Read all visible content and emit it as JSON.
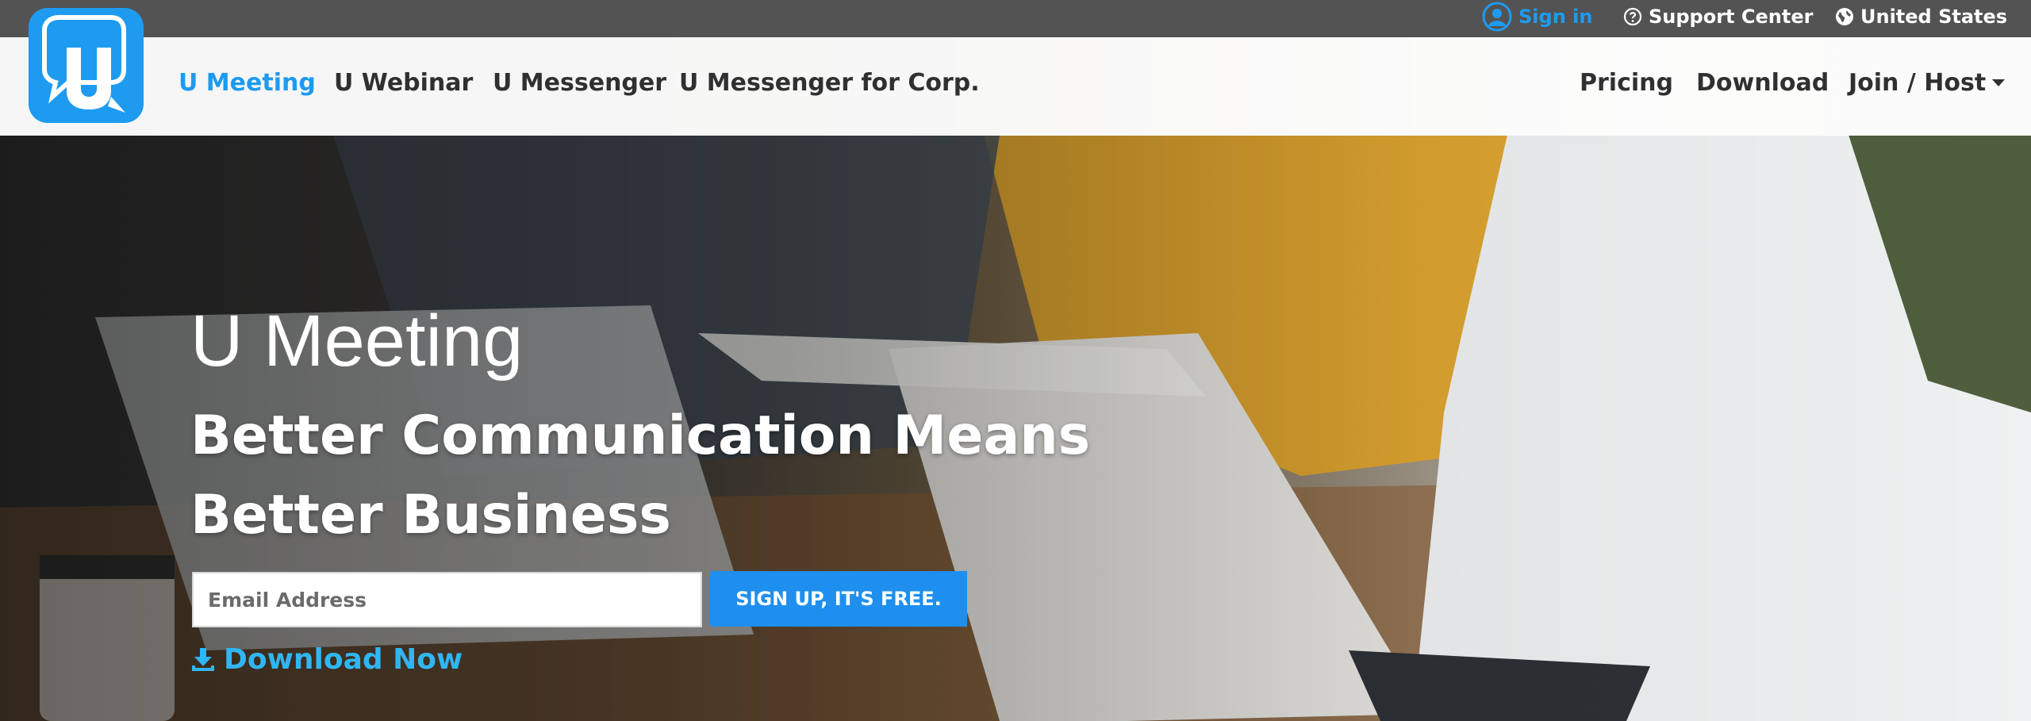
{
  "topbar": {
    "sign_in": "Sign in",
    "support": "Support Center",
    "country": "United States"
  },
  "nav": {
    "logo_letter": "U",
    "primary": [
      "U Meeting",
      "U Webinar",
      "U Messenger",
      "U Messenger for Corp."
    ],
    "active": "U Meeting",
    "secondary": [
      "Pricing",
      "Download",
      "Join / Host"
    ]
  },
  "hero": {
    "title": "U Meeting",
    "subtitle": "Better Communication Means Better Business",
    "email_placeholder": "Email Address",
    "signup_label": "SIGN UP, IT'S FREE.",
    "download_label": "Download Now"
  },
  "colors": {
    "brand_blue": "#1e9bf0",
    "topbar_bg": "#535353",
    "nav_text": "#303030",
    "download_link": "#2fb6f3"
  },
  "icons": [
    "user-circle-icon",
    "question-circle-icon",
    "globe-icon",
    "chevron-down-icon",
    "download-icon",
    "chat-bubble-logo"
  ]
}
